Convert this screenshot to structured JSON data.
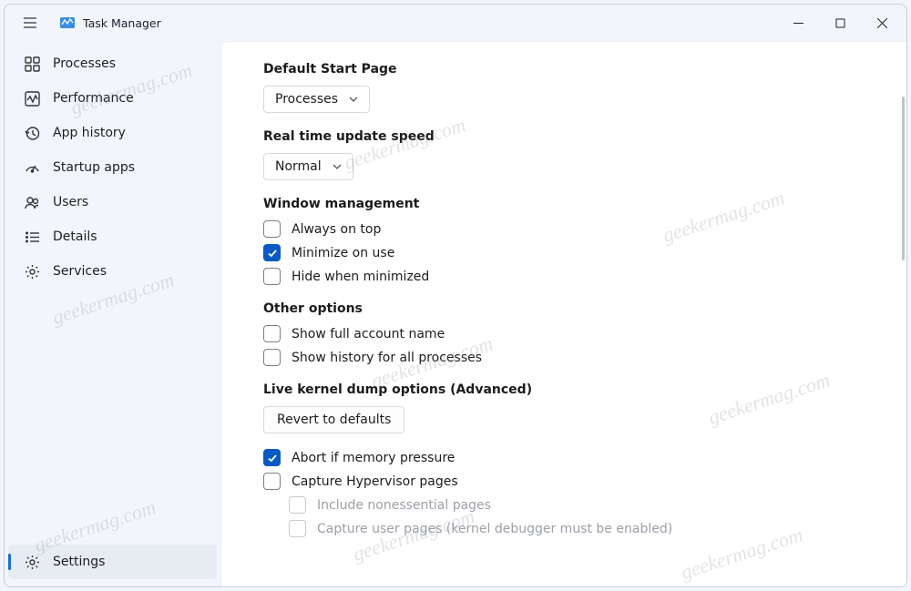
{
  "app": {
    "title": "Task Manager"
  },
  "sidebar": {
    "items": [
      {
        "label": "Processes"
      },
      {
        "label": "Performance"
      },
      {
        "label": "App history"
      },
      {
        "label": "Startup apps"
      },
      {
        "label": "Users"
      },
      {
        "label": "Details"
      },
      {
        "label": "Services"
      }
    ],
    "settings_label": "Settings"
  },
  "settings": {
    "default_start_page": {
      "title": "Default Start Page",
      "value": "Processes"
    },
    "update_speed": {
      "title": "Real time update speed",
      "value": "Normal"
    },
    "window_mgmt": {
      "title": "Window management",
      "always_on_top": "Always on top",
      "minimize_on_use": "Minimize on use",
      "hide_when_minimized": "Hide when minimized"
    },
    "other": {
      "title": "Other options",
      "show_full_name": "Show full account name",
      "show_all_history": "Show history for all processes"
    },
    "kernel": {
      "title": "Live kernel dump options (Advanced)",
      "revert": "Revert to defaults",
      "abort_mem": "Abort if memory pressure",
      "capture_hv": "Capture Hypervisor pages",
      "include_noness": "Include nonessential pages",
      "capture_user": "Capture user pages (kernel debugger must be enabled)"
    }
  },
  "watermark": "geekermag.com"
}
